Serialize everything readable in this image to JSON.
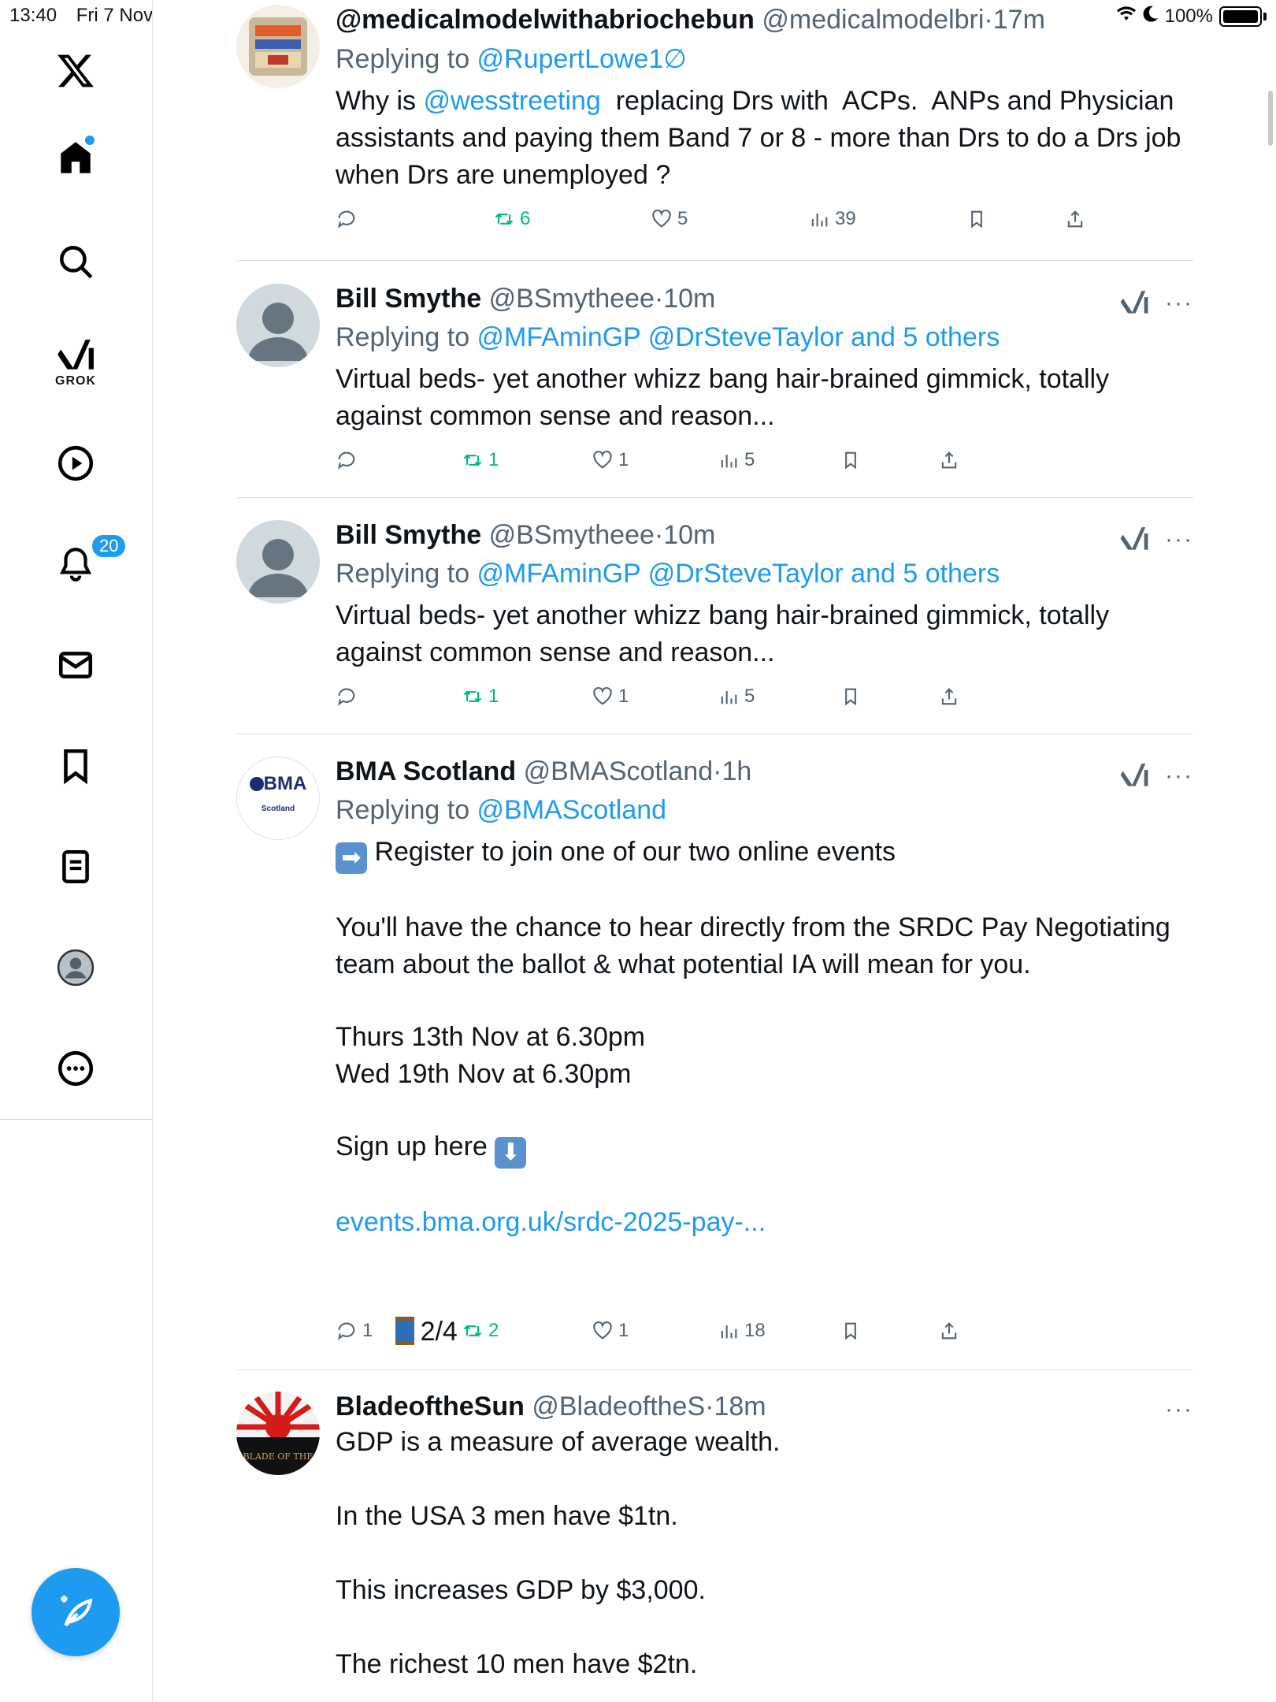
{
  "status": {
    "time": "13:40",
    "date": "Fri 7 Nov",
    "battery": "100%"
  },
  "sidebar": {
    "notification_count": "20",
    "grok_label": "GROK"
  },
  "colors": {
    "accent": "#1d9bf0",
    "retweet_green": "#00ba7c",
    "muted": "#536471"
  },
  "tweets": [
    {
      "name": "@medicalmodelwithabriochebun",
      "handle": "@medicalmodelbri",
      "time": "17m",
      "replying_prefix": "Replying to ",
      "replying_to": "@RupertLowe1∅",
      "text_1": "Why is ",
      "mention": "@wesstreeting",
      "text_2": "  replacing Drs with  ACPs.  ANPs and Physician assistants and paying them Band 7 or 8 - more than Drs to do a Drs job when Drs are unemployed ?",
      "replies": "",
      "retweets": "6",
      "likes": "5",
      "views": "39"
    },
    {
      "name": "Bill Smythe",
      "handle": "@BSmytheee",
      "time": "10m",
      "replying_prefix": "Replying to ",
      "replying_to": "@MFAminGP @DrSteveTaylor and 5 others",
      "text": "Virtual beds- yet another whizz bang hair-brained gimmick, totally against common sense and reason...",
      "replies": "",
      "retweets": "1",
      "likes": "1",
      "views": "5"
    },
    {
      "name": "Bill Smythe",
      "handle": "@BSmytheee",
      "time": "10m",
      "replying_prefix": "Replying to ",
      "replying_to": "@MFAminGP @DrSteveTaylor and 5 others",
      "text": "Virtual beds- yet another whizz bang hair-brained gimmick, totally against common sense and reason...",
      "replies": "",
      "retweets": "1",
      "likes": "1",
      "views": "5"
    },
    {
      "name": "BMA Scotland",
      "handle": "@BMAScotland",
      "time": "1h",
      "replying_prefix": "Replying to ",
      "replying_to": "@BMAScotland",
      "avatar_logo": "BMA",
      "avatar_sub": "Scotland",
      "line_1": "Register to join one of our two online events",
      "line_2": "You'll have the chance to hear directly from the SRDC Pay Negotiating team about the ballot & what potential IA will mean for you.",
      "line_3": "Thurs 13th Nov at 6.30pm\nWed 19th Nov at 6.30pm",
      "line_4": "Sign up here",
      "url": "events.bma.org.uk/srdc-2025-pay-...",
      "thread": "2/4",
      "replies": "1",
      "retweets": "2",
      "likes": "1",
      "views": "18"
    },
    {
      "name": "BladeoftheSun",
      "handle": "@BladeoftheS",
      "time": "18m",
      "avatar_text": "BLADE OF THE",
      "text": "GDP is a measure of average wealth.\n\nIn the USA 3 men have $1tn.\n\nThis increases GDP by $3,000.\n\nThe richest 10 men have $2tn."
    }
  ]
}
